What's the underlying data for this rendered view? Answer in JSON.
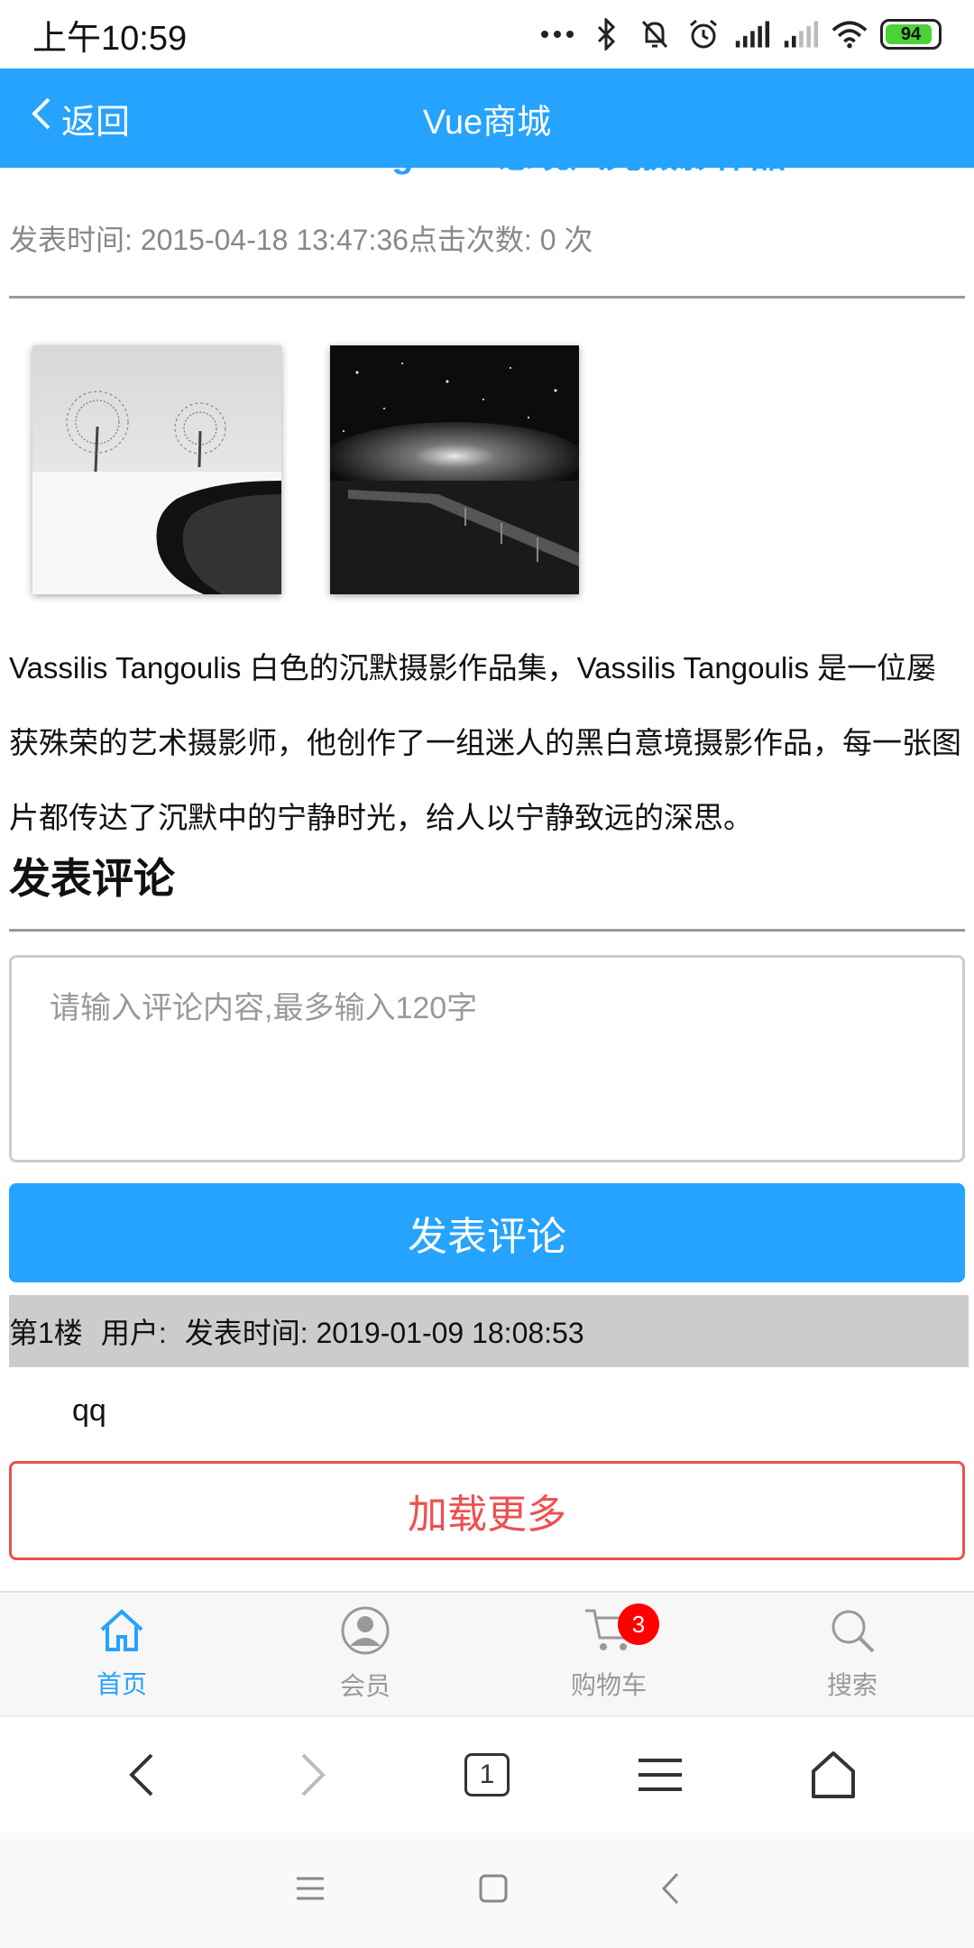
{
  "status_bar": {
    "time": "上午10:59",
    "battery": "94",
    "battery_color": "#4cd137"
  },
  "header": {
    "back_label": "返回",
    "title": "Vue商城",
    "color": "#26a2ff"
  },
  "article": {
    "title": "Vassilis Tangoulis意境风光摄影作品",
    "meta": "发表时间: 2015-04-18 13:47:36点击次数: 0 次",
    "images": [
      "snowy-trees-photo",
      "night-pier-photo"
    ],
    "description": "Vassilis Tangoulis 白色的沉默摄影作品集，Vassilis Tangoulis 是一位屡获殊荣的艺术摄影师，他创作了一组迷人的黑白意境摄影作品，每一张图片都传达了沉默中的宁静时光，给人以宁静致远的深思。"
  },
  "comments": {
    "heading": "发表评论",
    "placeholder": "请输入评论内容,最多输入120字",
    "submit_label": "发表评论",
    "items": [
      {
        "floor": "第1楼",
        "user": "用户:",
        "time": "发表时间: 2019-01-09 18:08:53",
        "content": "qq"
      }
    ],
    "load_more_label": "加载更多",
    "load_more_color": "#ef4f4f"
  },
  "tabbar": {
    "items": [
      {
        "label": "首页",
        "icon": "home-icon"
      },
      {
        "label": "会员",
        "icon": "member-icon"
      },
      {
        "label": "购物车",
        "icon": "cart-icon",
        "badge": "3"
      },
      {
        "label": "搜索",
        "icon": "search-icon"
      }
    ]
  },
  "browser_nav": {
    "tab_count": "1"
  }
}
